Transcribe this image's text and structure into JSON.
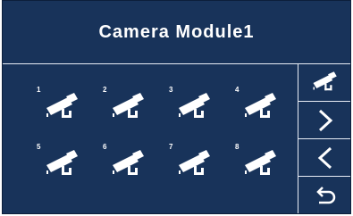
{
  "title": "Camera Module1",
  "cameras": [
    {
      "number": "1",
      "icon": "security-camera-icon"
    },
    {
      "number": "2",
      "icon": "security-camera-icon"
    },
    {
      "number": "3",
      "icon": "security-camera-icon"
    },
    {
      "number": "4",
      "icon": "security-camera-icon"
    },
    {
      "number": "5",
      "icon": "security-camera-icon"
    },
    {
      "number": "6",
      "icon": "security-camera-icon"
    },
    {
      "number": "7",
      "icon": "security-camera-icon"
    },
    {
      "number": "8",
      "icon": "security-camera-icon"
    }
  ],
  "side_buttons": [
    {
      "icon": "security-camera-icon"
    },
    {
      "icon": "chevron-right-icon"
    },
    {
      "icon": "chevron-left-icon"
    },
    {
      "icon": "return-arrow-icon"
    }
  ],
  "colors": {
    "background": "#18335a",
    "divider": "#e9eef6",
    "foreground": "#ffffff"
  }
}
